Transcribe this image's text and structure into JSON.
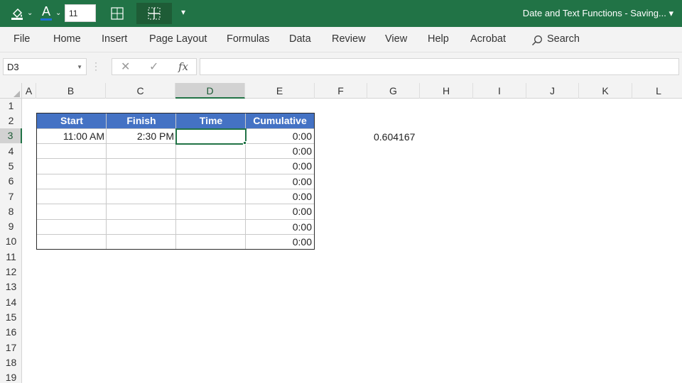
{
  "titlebar": {
    "font_size_value": "11",
    "document_title": "Date and Text Functions  -  Saving...",
    "accent_color": "#217346"
  },
  "menu": {
    "items": [
      "File",
      "Home",
      "Insert",
      "Page Layout",
      "Formulas",
      "Data",
      "Review",
      "View",
      "Help",
      "Acrobat"
    ],
    "search_label": "Search"
  },
  "formula_bar": {
    "name_box": "D3",
    "cancel_glyph": "✕",
    "enter_glyph": "✓",
    "fx_label": "fx",
    "formula_value": ""
  },
  "grid": {
    "columns": [
      "A",
      "B",
      "C",
      "D",
      "E",
      "F",
      "G",
      "H",
      "I",
      "J",
      "K",
      "L"
    ],
    "selected_column": "D",
    "rows": [
      "1",
      "2",
      "3",
      "4",
      "5",
      "6",
      "7",
      "8",
      "9",
      "10",
      "11",
      "12",
      "13",
      "14",
      "15",
      "16",
      "17",
      "18",
      "19"
    ],
    "selected_row": "3"
  },
  "table": {
    "headers": [
      "Start",
      "Finish",
      "Time",
      "Cumulative"
    ],
    "header_color": "#4472c4",
    "rows": [
      [
        "11:00 AM",
        "2:30 PM",
        "",
        "0:00"
      ],
      [
        "",
        "",
        "",
        "0:00"
      ],
      [
        "",
        "",
        "",
        "0:00"
      ],
      [
        "",
        "",
        "",
        "0:00"
      ],
      [
        "",
        "",
        "",
        "0:00"
      ],
      [
        "",
        "",
        "",
        "0:00"
      ],
      [
        "",
        "",
        "",
        "0:00"
      ],
      [
        "",
        "",
        "",
        "0:00"
      ]
    ]
  },
  "g3_value": "0.604167"
}
